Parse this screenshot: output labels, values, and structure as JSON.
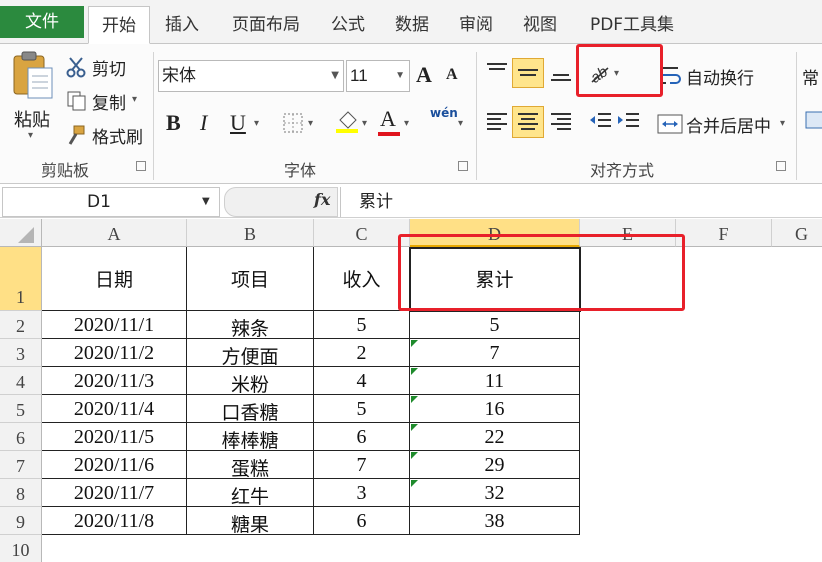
{
  "tabs": [
    "文件",
    "开始",
    "插入",
    "页面布局",
    "公式",
    "数据",
    "审阅",
    "视图",
    "PDF工具集"
  ],
  "clipboard": {
    "paste": "粘贴",
    "cut": "剪切",
    "copy": "复制",
    "format_painter": "格式刷",
    "group_label": "剪贴板"
  },
  "font": {
    "name": "宋体",
    "size": "11",
    "grow": "A",
    "shrink": "A",
    "bold": "B",
    "italic": "I",
    "underline": "U",
    "font_color_letter": "A",
    "phonetic": "wén",
    "group_label": "字体"
  },
  "alignment": {
    "wrap_text": "自动换行",
    "merge_center": "合并后居中",
    "group_label": "对齐方式"
  },
  "number": {
    "format_partial": "常"
  },
  "formula_bar": {
    "name_box": "D1",
    "fx": "fx",
    "content": "累计"
  },
  "sheet": {
    "columns": [
      "A",
      "B",
      "C",
      "D",
      "E",
      "F",
      "G"
    ],
    "rows": [
      "1",
      "2",
      "3",
      "4",
      "5",
      "6",
      "7",
      "8",
      "9",
      "10"
    ],
    "header": {
      "date": "日期",
      "item": "项目",
      "income": "收入",
      "cumulative": "累计"
    },
    "data": [
      {
        "date": "2020/11/1",
        "item": "辣条",
        "income": "5",
        "cumulative": "5"
      },
      {
        "date": "2020/11/2",
        "item": "方便面",
        "income": "2",
        "cumulative": "7"
      },
      {
        "date": "2020/11/3",
        "item": "米粉",
        "income": "4",
        "cumulative": "11"
      },
      {
        "date": "2020/11/4",
        "item": "口香糖",
        "income": "5",
        "cumulative": "16"
      },
      {
        "date": "2020/11/5",
        "item": "棒棒糖",
        "income": "6",
        "cumulative": "22"
      },
      {
        "date": "2020/11/6",
        "item": "蛋糕",
        "income": "7",
        "cumulative": "29"
      },
      {
        "date": "2020/11/7",
        "item": "红牛",
        "income": "3",
        "cumulative": "32"
      },
      {
        "date": "2020/11/8",
        "item": "糖果",
        "income": "6",
        "cumulative": "38"
      }
    ]
  },
  "colors": {
    "file_tab": "#2b8a3e",
    "selection": "#ffe086",
    "highlight_box": "#e8202a",
    "error_marker": "#1f8b2c"
  },
  "icons": [
    "paste-icon",
    "scissors-icon",
    "copy-icon",
    "brush-icon",
    "border-icon",
    "fill-color-icon",
    "align-top-icon",
    "align-middle-icon",
    "align-bottom-icon",
    "orientation-icon",
    "wrap-text-icon",
    "merge-center-icon",
    "indent-icon"
  ]
}
